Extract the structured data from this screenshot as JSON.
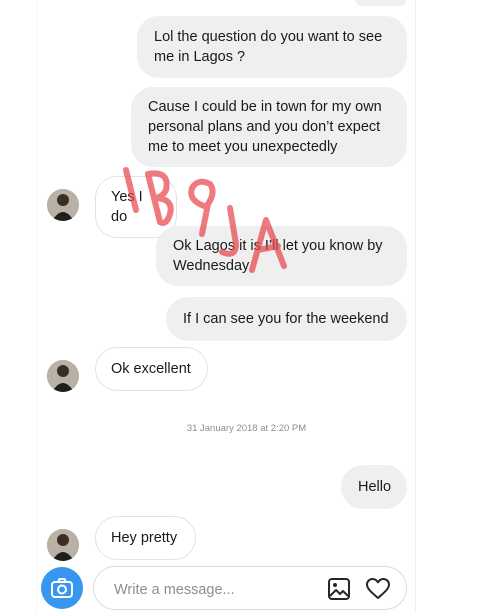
{
  "conversation": {
    "messages": [
      {
        "sender": "me",
        "text": "Lol the question do you want to see me in Lagos ?"
      },
      {
        "sender": "me",
        "text": "Cause I could be in town for my own personal plans and you don’t expect me to meet you unexpectedly"
      },
      {
        "sender": "them",
        "text": "Yes I do"
      },
      {
        "sender": "me",
        "text": "Ok Lagos it is I’ll let you know by Wednesday"
      },
      {
        "sender": "me",
        "text": "If I can see you for the weekend"
      },
      {
        "sender": "them",
        "text": "Ok excellent"
      },
      {
        "sender": "me",
        "text": "Hello"
      },
      {
        "sender": "them",
        "text": "Hey pretty"
      }
    ],
    "timestamp": "31 January 2018 at 2:20 PM"
  },
  "watermark": {
    "text": "IB9JA",
    "color": "#e8474f"
  },
  "composer": {
    "placeholder": "Write a message...",
    "camera_icon": "camera-icon",
    "gallery_icon": "image-icon",
    "like_icon": "heart-icon",
    "accent_color": "#3797f0"
  }
}
